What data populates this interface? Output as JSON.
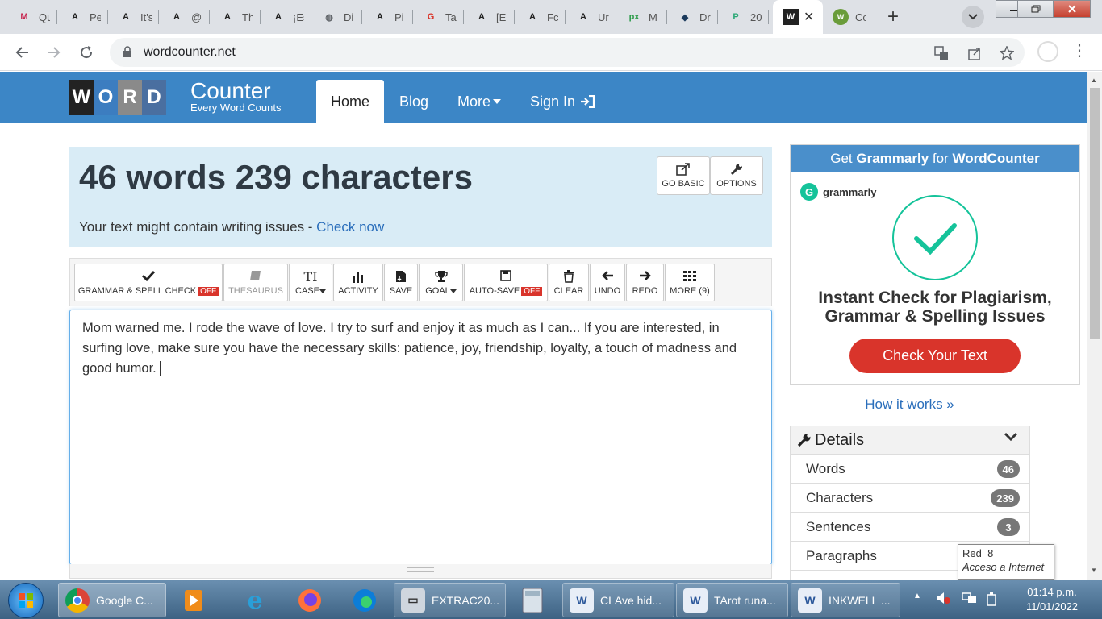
{
  "browser": {
    "tabs": [
      {
        "title": "Qu",
        "fav": "M",
        "color": "#c7254e"
      },
      {
        "title": "Pe",
        "fav": "A",
        "color": "#222"
      },
      {
        "title": "It's",
        "fav": "A",
        "color": "#222"
      },
      {
        "title": "@",
        "fav": "A",
        "color": "#222"
      },
      {
        "title": "Th",
        "fav": "A",
        "color": "#222"
      },
      {
        "title": "¡Es",
        "fav": "A",
        "color": "#222"
      },
      {
        "title": "Di",
        "fav": "◍",
        "color": "#5f6368"
      },
      {
        "title": "Pi",
        "fav": "A",
        "color": "#222"
      },
      {
        "title": "Ta",
        "fav": "G",
        "color": "#d93025"
      },
      {
        "title": "[E",
        "fav": "A",
        "color": "#222"
      },
      {
        "title": "Fc",
        "fav": "A",
        "color": "#222"
      },
      {
        "title": "Ur",
        "fav": "A",
        "color": "#222"
      },
      {
        "title": "M",
        "fav": "px",
        "color": "#2d9c4a"
      },
      {
        "title": "Dr",
        "fav": "◆",
        "color": "#1b3a5c"
      },
      {
        "title": "20",
        "fav": "P",
        "color": "#2aa876"
      }
    ],
    "active_tab": {
      "fav": "W",
      "close": "✕"
    },
    "last_tab": {
      "title": "Cc",
      "fav": "W",
      "color": "#6a9c3a"
    },
    "new_tab": "+",
    "url": "wordcounter.net"
  },
  "site": {
    "logo_letters": [
      "W",
      "O",
      "R",
      "D"
    ],
    "logo_colors": [
      "#222",
      "#3c7dc0",
      "#8a8a8a",
      "#4a6fa0"
    ],
    "logo_title": "Counter",
    "logo_tagline": "Every Word Counts",
    "nav": {
      "home": "Home",
      "blog": "Blog",
      "more": "More",
      "signin": "Sign In"
    }
  },
  "counter": {
    "headline": "46 words 239 characters",
    "issues_text": "Your text might contain writing issues - ",
    "check_link": "Check now",
    "go_basic": "GO BASIC",
    "options": "OPTIONS"
  },
  "editor_toolbar": {
    "grammar": "GRAMMAR & SPELL CHECK",
    "off": "OFF",
    "thesaurus": "THESAURUS",
    "case": "CASE",
    "activity": "ACTIVITY",
    "save": "SAVE",
    "goal": "GOAL",
    "autosave": "AUTO-SAVE",
    "clear": "CLEAR",
    "undo": "UNDO",
    "redo": "REDO",
    "more": "MORE (9)"
  },
  "editor": {
    "text": "Mom warned me. I rode the wave of love. I try to surf and enjoy it as much as I can... If you are interested, in surfing love, make sure you have the necessary skills: patience, joy, friendship, loyalty, a touch of madness and good humor."
  },
  "ad": {
    "header_pre": "Get ",
    "header_brand": "Grammarly",
    "header_mid": " for ",
    "header_site": "WordCounter",
    "brand": "grammarly",
    "headline_1": "Instant Check for Plagiarism,",
    "headline_2": "Grammar & Spelling Issues",
    "cta": "Check Your Text",
    "how": "How it works »"
  },
  "details": {
    "title": "Details",
    "rows": [
      {
        "label": "Words",
        "value": "46"
      },
      {
        "label": "Characters",
        "value": "239"
      },
      {
        "label": "Sentences",
        "value": "3"
      },
      {
        "label": "Paragraphs",
        "value": ""
      }
    ]
  },
  "tooltip": {
    "line1": "Red  8",
    "line2": "Acceso a Internet"
  },
  "taskbar": {
    "chrome": "Google C...",
    "extract": "EXTRAC20...",
    "doc1": "CLAve hid...",
    "doc2": "TArot runa...",
    "doc3": "INKWELL ...",
    "time": "01:14 p.m.",
    "date": "11/01/2022"
  },
  "colors": {
    "header_blue": "#3c86c6",
    "counter_bg": "#d9ecf6",
    "badge_red": "#d9342b",
    "link": "#2a6ebb",
    "grammarly_green": "#15c39a"
  }
}
